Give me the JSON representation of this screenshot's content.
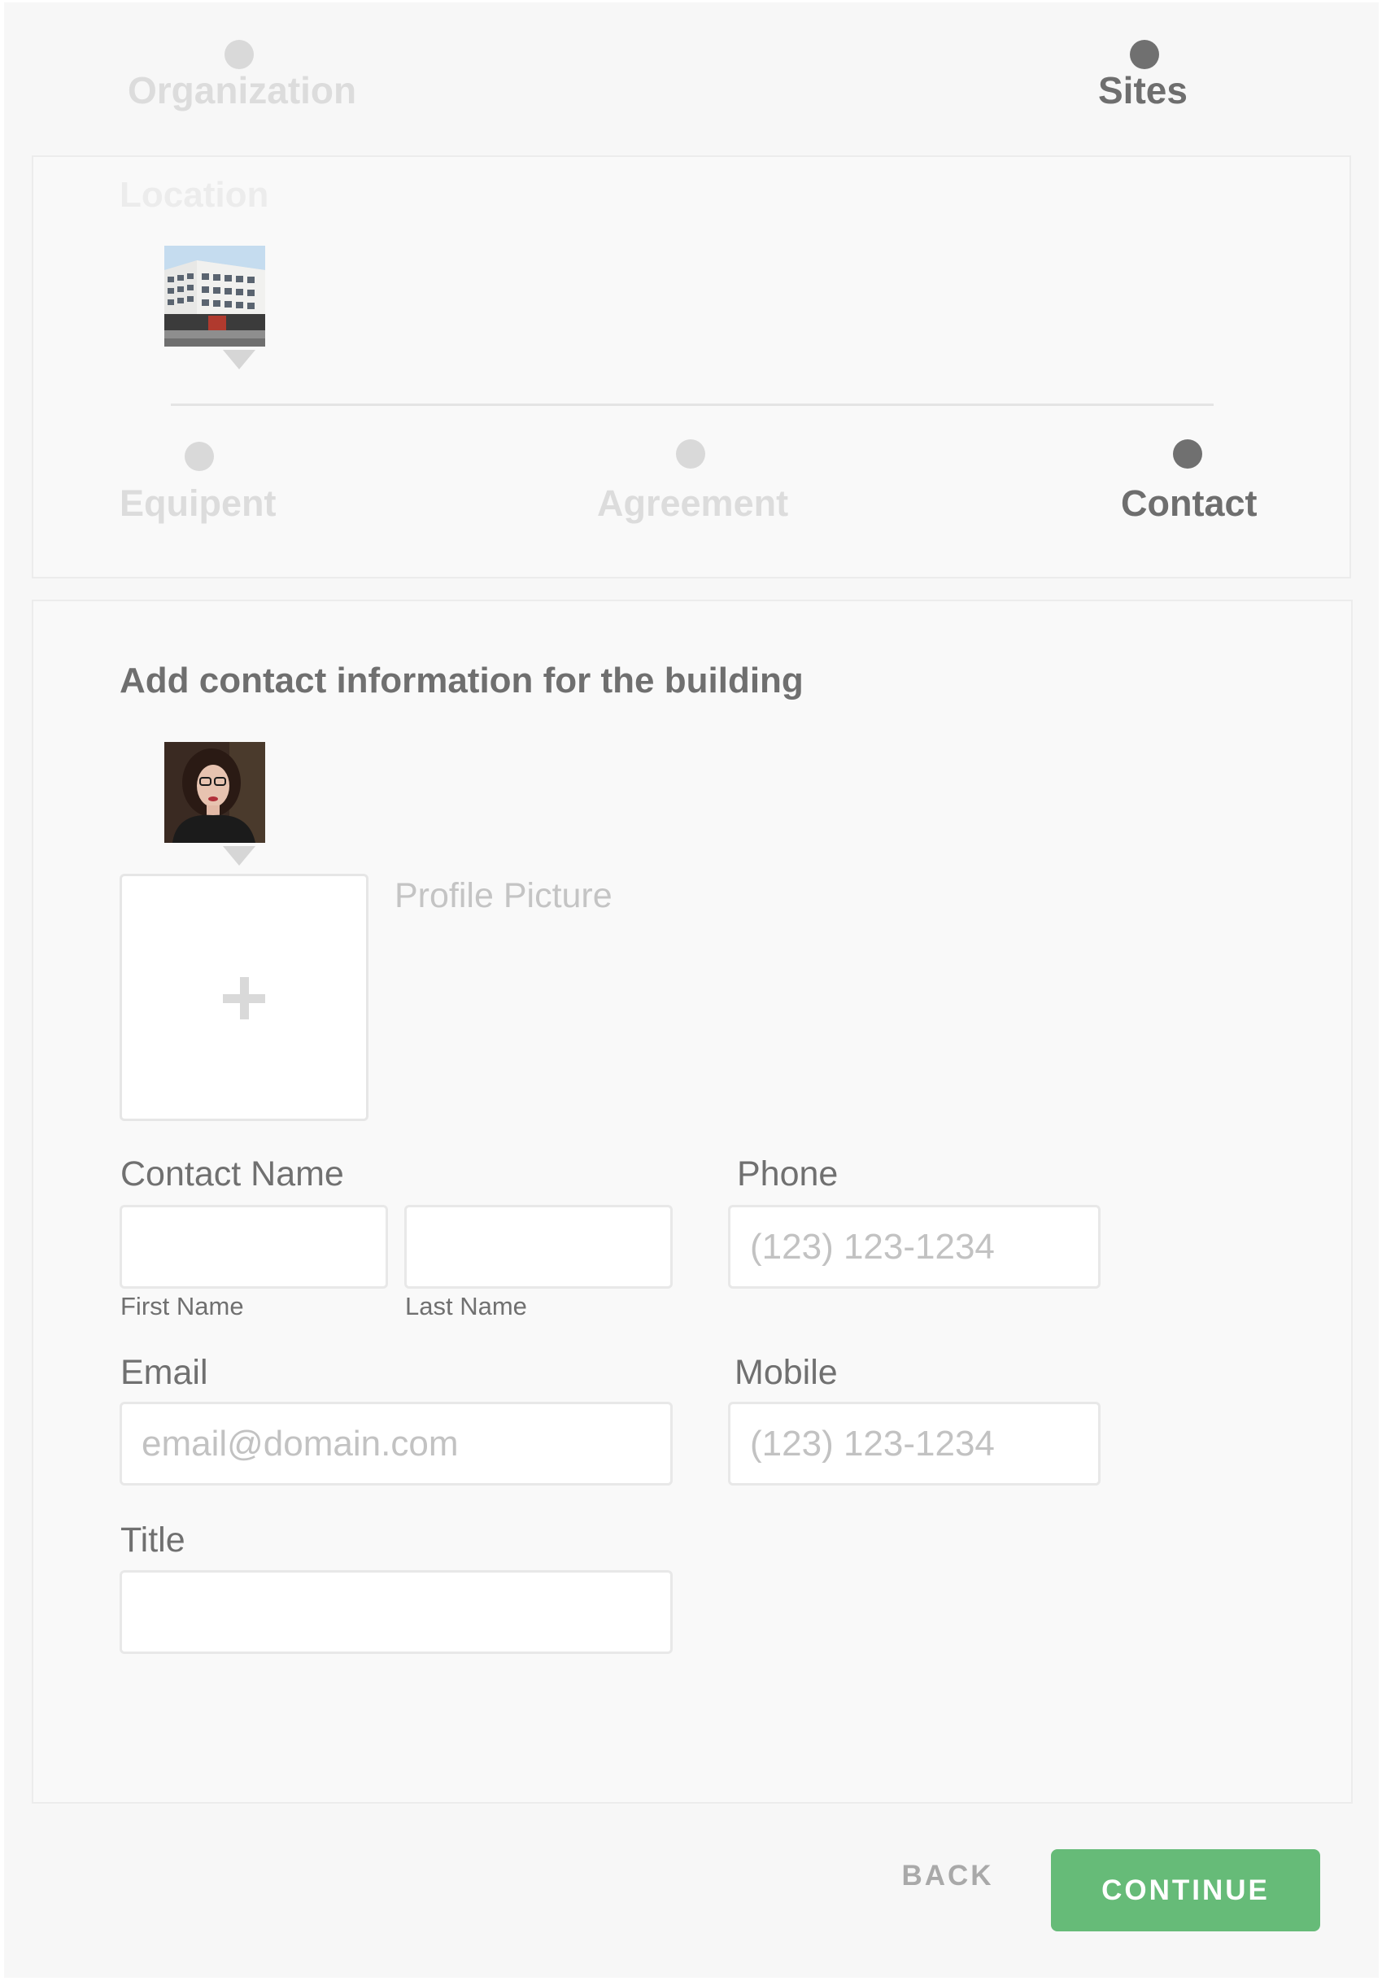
{
  "progress": {
    "steps": [
      {
        "label": "Organization",
        "state": "inactive"
      },
      {
        "label": "Sites",
        "state": "active"
      }
    ]
  },
  "sites": {
    "location_label": "Location",
    "substeps": [
      {
        "label": "Equipent",
        "state": "inactive"
      },
      {
        "label": "Agreement",
        "state": "inactive"
      },
      {
        "label": "Contact",
        "state": "active"
      }
    ]
  },
  "form": {
    "heading": "Add contact information for the building",
    "profile_picture_label": "Profile Picture",
    "contact_name_label": "Contact Name",
    "first_name_label": "First Name",
    "last_name_label": "Last Name",
    "first_name_value": "",
    "last_name_value": "",
    "phone_label": "Phone",
    "phone_placeholder": "(123) 123-1234",
    "email_label": "Email",
    "email_placeholder": "email@domain.com",
    "mobile_label": "Mobile",
    "mobile_placeholder": "(123) 123-1234",
    "title_label": "Title",
    "title_value": ""
  },
  "actions": {
    "back_label": "BACK",
    "continue_label": "CONTINUE"
  },
  "colors": {
    "accent": "#66bb78",
    "active_dot": "#707070",
    "inactive_dot": "#d9d9d9"
  }
}
